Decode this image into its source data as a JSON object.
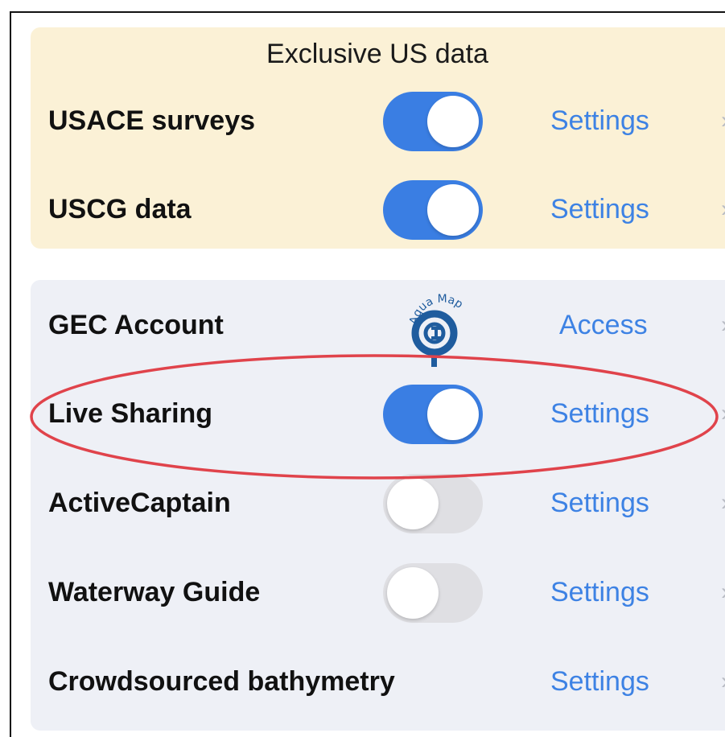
{
  "us_section": {
    "title": "Exclusive US data",
    "rows": [
      {
        "label": "USACE surveys",
        "toggle": "on",
        "action": "Settings"
      },
      {
        "label": "USCG data",
        "toggle": "on",
        "action": "Settings"
      }
    ]
  },
  "general_section": {
    "rows": [
      {
        "label": "GEC Account",
        "logo": "aqua-map-logo",
        "logo_text": "Aqua Map",
        "action": "Access"
      },
      {
        "label": "Live Sharing",
        "toggle": "on",
        "action": "Settings",
        "highlighted": true
      },
      {
        "label": "ActiveCaptain",
        "toggle": "off",
        "action": "Settings"
      },
      {
        "label": "Waterway Guide",
        "toggle": "off",
        "action": "Settings"
      },
      {
        "label": "Crowdsourced bathymetry",
        "action": "Settings"
      }
    ]
  },
  "colors": {
    "toggle_on": "#3a7ee3",
    "toggle_off": "#dfdfe3",
    "link": "#3d82e4",
    "us_panel_bg": "#fbf1d6",
    "general_panel_bg": "#eef0f6",
    "highlight_ellipse": "#e0434b"
  },
  "icons": {
    "row_chevron": "chevron-right-icon"
  }
}
